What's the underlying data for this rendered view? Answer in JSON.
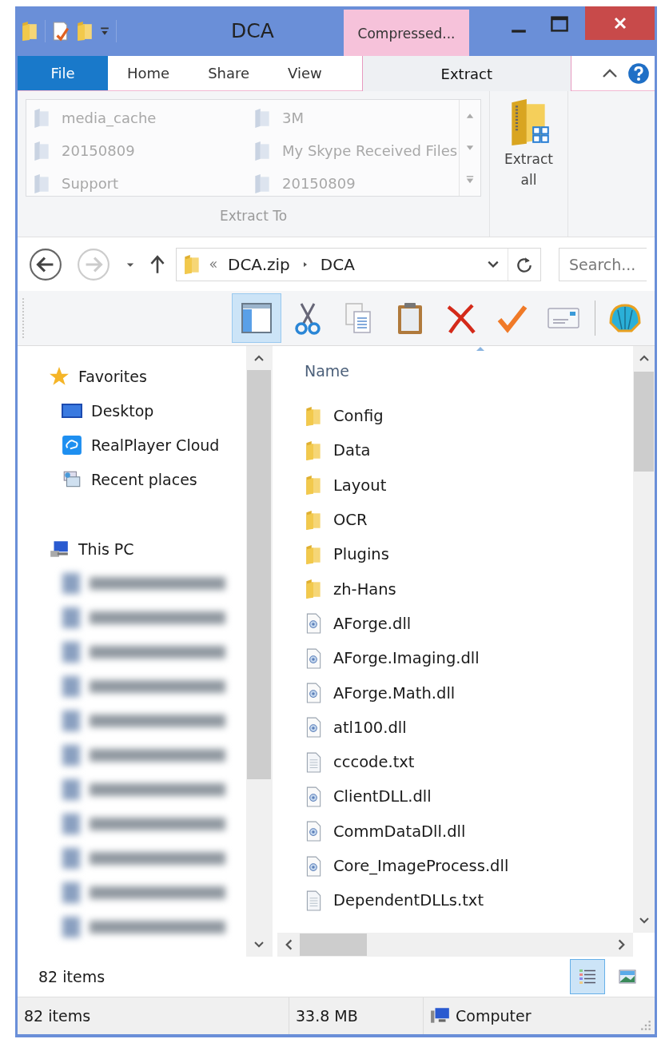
{
  "window": {
    "title": "DCA",
    "context_tab": "Compressed..."
  },
  "ribbon": {
    "tabs": [
      {
        "label": "File",
        "kind": "file",
        "selected": false
      },
      {
        "label": "Home",
        "kind": "tab",
        "selected": false
      },
      {
        "label": "Share",
        "kind": "tab",
        "selected": false
      },
      {
        "label": "View",
        "kind": "tab",
        "selected": false
      },
      {
        "label": "Extract",
        "kind": "context",
        "selected": true
      }
    ],
    "destinations": [
      {
        "label": "media_cache",
        "disabled": true
      },
      {
        "label": "3M",
        "disabled": true
      },
      {
        "label": "20150809",
        "disabled": true
      },
      {
        "label": "My Skype Received Files",
        "disabled": true
      },
      {
        "label": "Support",
        "disabled": true
      },
      {
        "label": "20150809",
        "disabled": true
      }
    ],
    "group_label": "Extract To",
    "extract_all": "Extract all"
  },
  "address_bar": {
    "path": [
      "DCA.zip",
      "DCA"
    ],
    "search_placeholder": "Search..."
  },
  "toolbar": [
    {
      "kind": "layout",
      "selected": true
    },
    {
      "kind": "cut",
      "selected": false
    },
    {
      "kind": "copy",
      "selected": false
    },
    {
      "kind": "paste",
      "selected": false
    },
    {
      "kind": "delete",
      "selected": false
    },
    {
      "kind": "check",
      "selected": false
    },
    {
      "kind": "card",
      "selected": false
    },
    {
      "kind": "shell",
      "selected": false
    }
  ],
  "nav_pane": {
    "groups": [
      {
        "label": "Favorites",
        "kind": "favorites",
        "children": [
          {
            "label": "Desktop",
            "kind": "desktop"
          },
          {
            "label": "RealPlayer Cloud",
            "kind": "cloud"
          },
          {
            "label": "Recent places",
            "kind": "recent"
          }
        ]
      },
      {
        "label": "This PC",
        "kind": "pc",
        "children": [
          {
            "kind": "blurred"
          },
          {
            "kind": "blurred"
          },
          {
            "kind": "blurred"
          },
          {
            "kind": "blurred"
          },
          {
            "kind": "blurred"
          },
          {
            "kind": "blurred"
          },
          {
            "kind": "blurred"
          },
          {
            "kind": "blurred"
          },
          {
            "kind": "blurred"
          },
          {
            "kind": "blurred"
          },
          {
            "kind": "blurred"
          }
        ]
      }
    ]
  },
  "file_list": {
    "column": "Name",
    "files": [
      {
        "name": "Config",
        "kind": "folder"
      },
      {
        "name": "Data",
        "kind": "folder"
      },
      {
        "name": "Layout",
        "kind": "folder"
      },
      {
        "name": "OCR",
        "kind": "folder"
      },
      {
        "name": "Plugins",
        "kind": "folder"
      },
      {
        "name": "zh-Hans",
        "kind": "folder"
      },
      {
        "name": "AForge.dll",
        "kind": "dll"
      },
      {
        "name": "AForge.Imaging.dll",
        "kind": "dll"
      },
      {
        "name": "AForge.Math.dll",
        "kind": "dll"
      },
      {
        "name": "atl100.dll",
        "kind": "dll"
      },
      {
        "name": "cccode.txt",
        "kind": "txt"
      },
      {
        "name": "ClientDLL.dll",
        "kind": "dll"
      },
      {
        "name": "CommDataDll.dll",
        "kind": "dll"
      },
      {
        "name": "Core_ImageProcess.dll",
        "kind": "dll"
      },
      {
        "name": "DependentDLLs.txt",
        "kind": "txt"
      }
    ]
  },
  "details_pane": {
    "count": "82 items",
    "views": [
      {
        "kind": "details",
        "selected": true
      },
      {
        "kind": "preview",
        "selected": false
      }
    ]
  },
  "status_bar": [
    {
      "text": "82 items",
      "kind": "text"
    },
    {
      "text": "33.8 MB",
      "kind": "text"
    },
    {
      "text": "Computer",
      "kind": "computer"
    }
  ]
}
